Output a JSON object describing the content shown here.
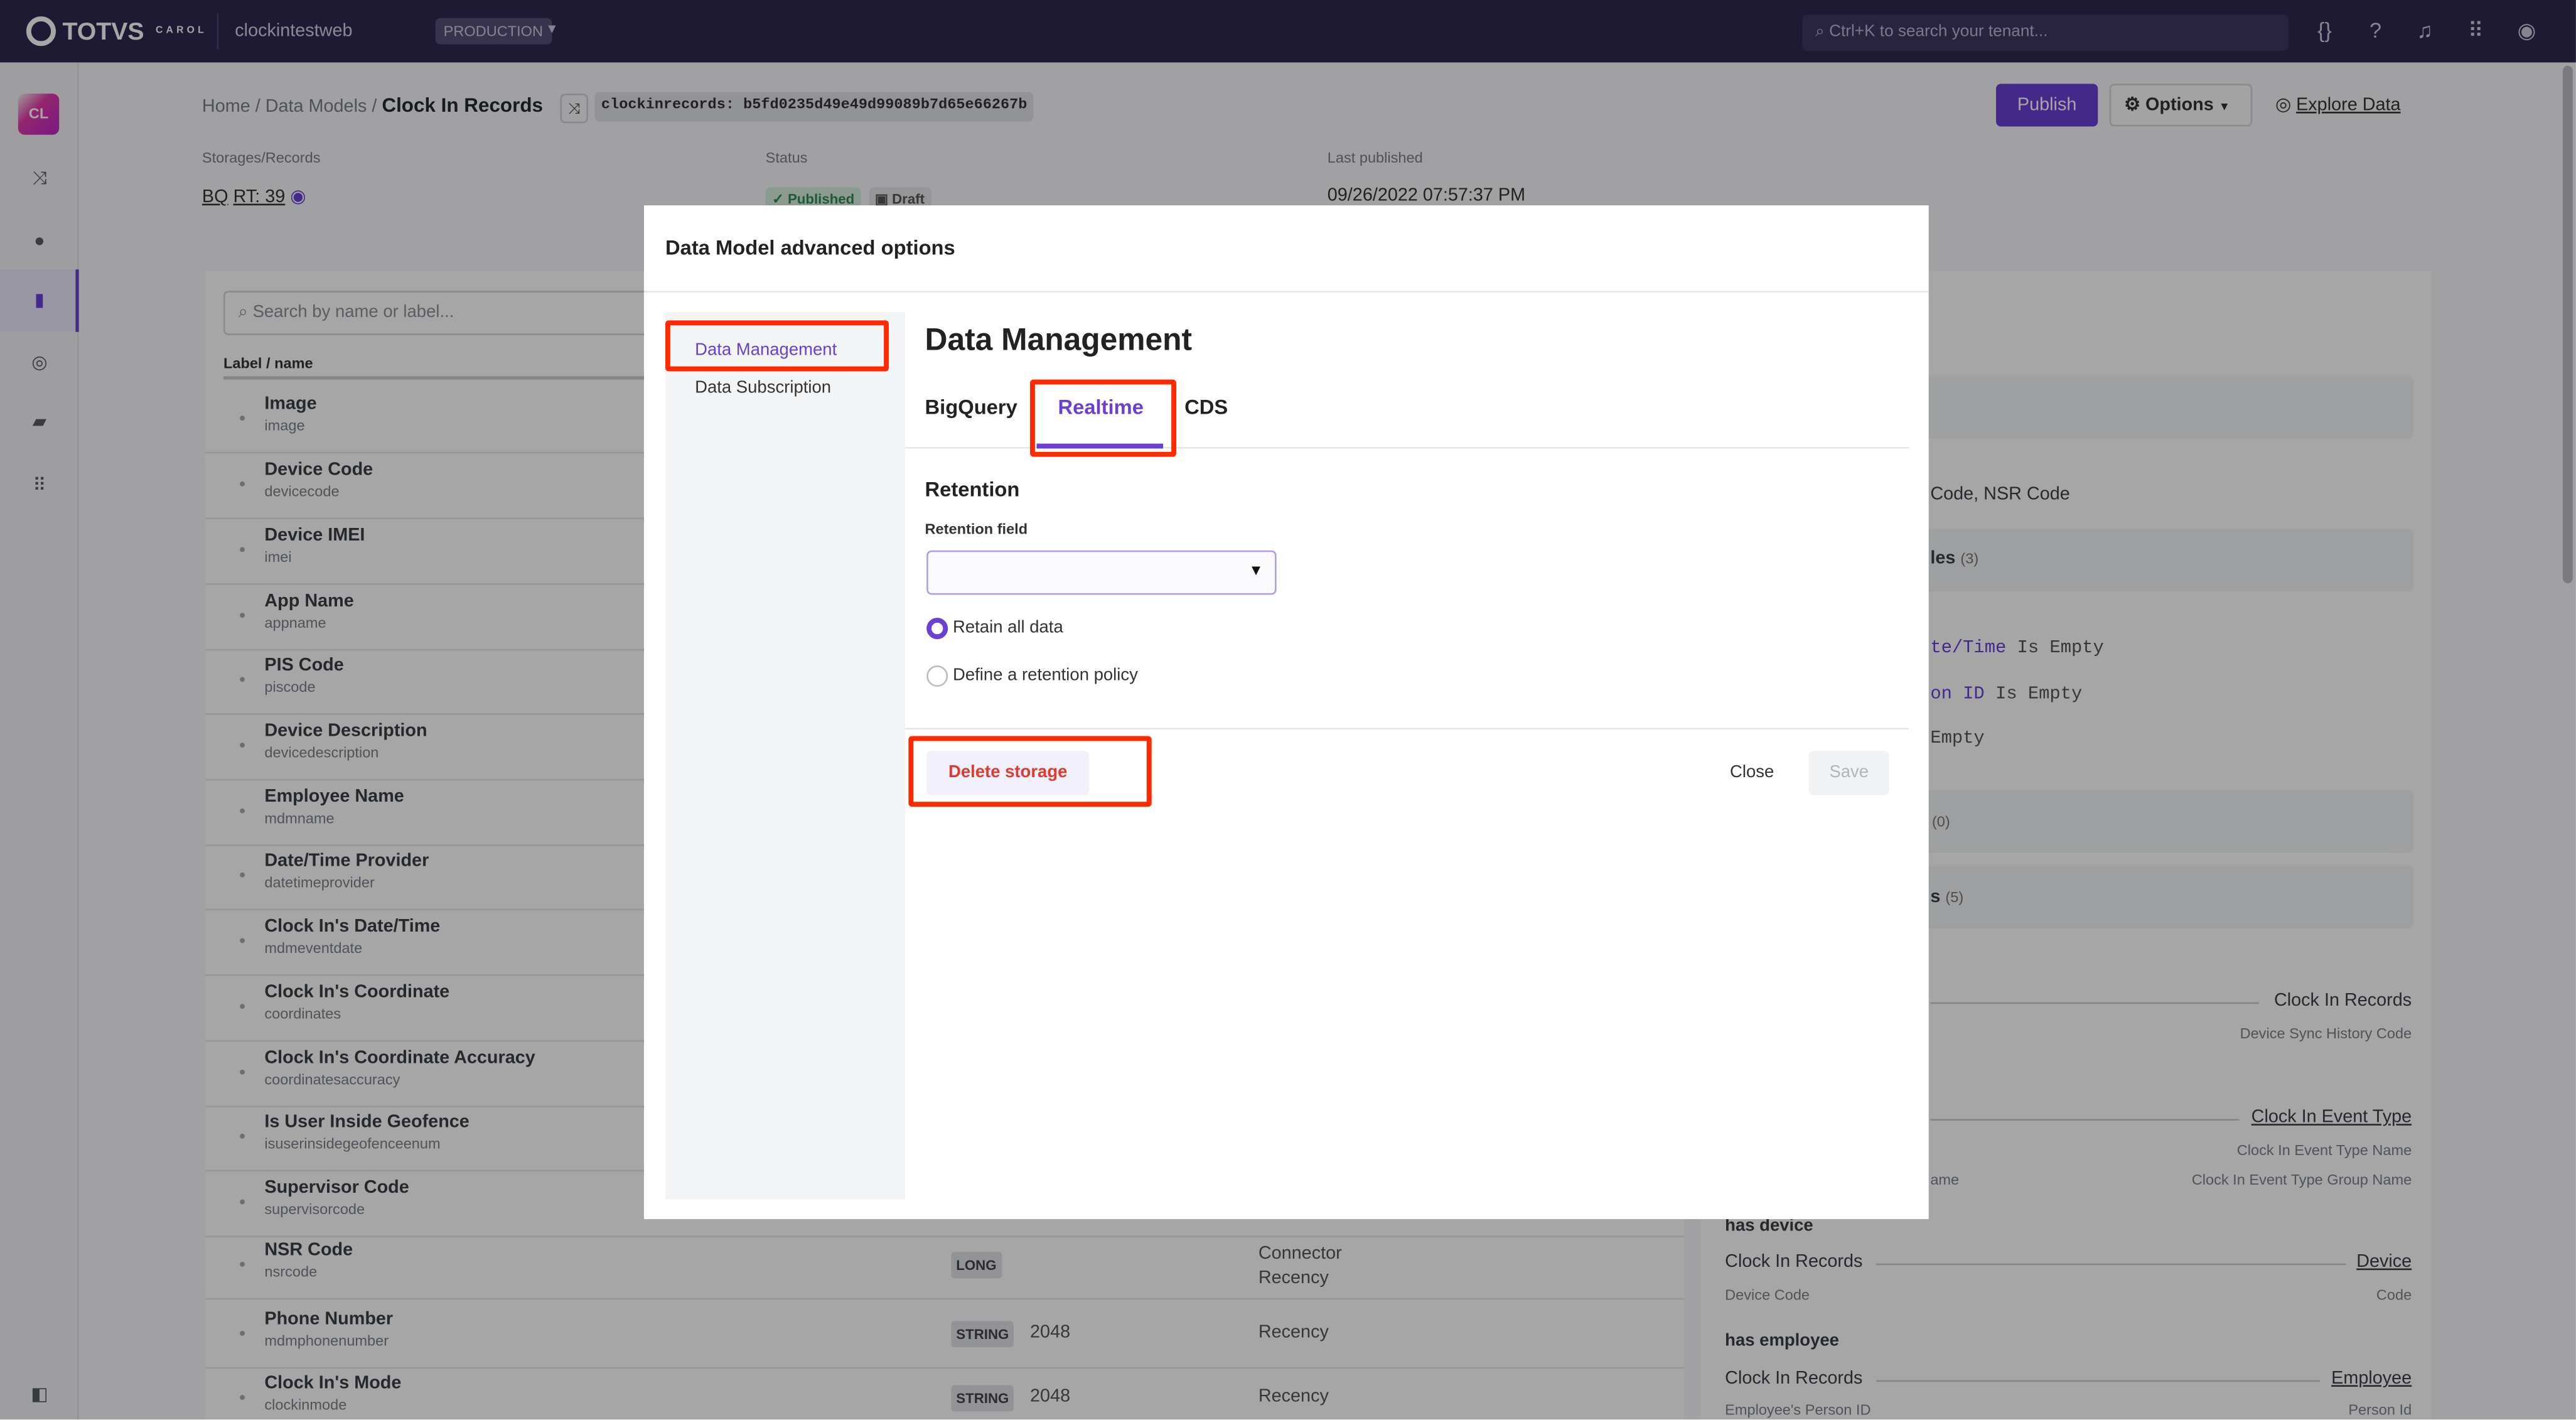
{
  "topbar": {
    "brand": "TOTVS",
    "brand_sub": "CAROL",
    "tenant": "clockintestweb",
    "environment": "PRODUCTION",
    "search_placeholder": "Ctrl+K to search your tenant...",
    "icons": [
      "code-braces-icon",
      "help-icon",
      "bell-icon",
      "apps-grid-icon",
      "user-icon"
    ]
  },
  "sidebar": {
    "avatar": "CL",
    "icons": [
      "shuffle-icon",
      "location-pin-icon",
      "database-icon",
      "compass-icon",
      "chat-icon",
      "apps-grid-icon"
    ],
    "active_index": 2,
    "collapse_icon": "sidebar-toggle-icon"
  },
  "header": {
    "breadcrumb_home": "Home",
    "breadcrumb_models": "Data Models",
    "breadcrumb_current": "Clock In Records",
    "hash": "clockinrecords: b5fd0235d49e49d99089b7d65e66267b",
    "storages_label": "Storages/Records",
    "storage_bq": "BQ",
    "storage_rt": "RT: 39",
    "status_label": "Status",
    "status_published": "Published",
    "status_draft": "Draft",
    "last_published_label": "Last published",
    "last_published": "09/26/2022 07:57:37 PM",
    "publish": "Publish",
    "options": "Options",
    "explore": "Explore Data"
  },
  "fields": {
    "search_placeholder": "Search by name or label...",
    "column_label": "Label / name",
    "rows": [
      {
        "label": "Image",
        "name": "image"
      },
      {
        "label": "Device Code",
        "name": "devicecode"
      },
      {
        "label": "Device IMEI",
        "name": "imei"
      },
      {
        "label": "App Name",
        "name": "appname"
      },
      {
        "label": "PIS Code",
        "name": "piscode"
      },
      {
        "label": "Device Description",
        "name": "devicedescription"
      },
      {
        "label": "Employee Name",
        "name": "mdmname"
      },
      {
        "label": "Date/Time Provider",
        "name": "datetimeprovider"
      },
      {
        "label": "Clock In's Date/Time",
        "name": "mdmeventdate"
      },
      {
        "label": "Clock In's Coordinate",
        "name": "coordinates"
      },
      {
        "label": "Clock In's Coordinate Accuracy",
        "name": "coordinatesaccuracy"
      },
      {
        "label": "Is User Inside Geofence",
        "name": "isuserinsidegeofenceenum"
      },
      {
        "label": "Supervisor Code",
        "name": "supervisorcode"
      },
      {
        "label": "NSR Code",
        "name": "nsrcode",
        "type": "LONG",
        "size": "",
        "meta1": "Connector",
        "meta2": "Recency"
      },
      {
        "label": "Phone Number",
        "name": "mdmphonenumber",
        "type": "STRING",
        "size": "2048",
        "meta1": "Recency",
        "meta2": ""
      },
      {
        "label": "Clock In's Mode",
        "name": "clockinmode",
        "type": "STRING",
        "size": "2048",
        "meta1": "Recency",
        "meta2": ""
      }
    ]
  },
  "right_panel": {
    "keys_text": "Code, NSR Code",
    "rules_title": "les",
    "rules_count": "(3)",
    "rule1_field": "te/Time",
    "rule1_op": "Is Empty",
    "rule2_field": "on ID",
    "rule2_op": "Is Empty",
    "rule3_op": "Empty",
    "section3_count": "(0)",
    "section4_title": "s",
    "section4_count": "(5)",
    "rel1_target": "Clock In Records",
    "rel1_target_field": "Device Sync History Code",
    "rel2_target": "Clock In Event Type",
    "rel2_target_field1": "Clock In Event Type Name",
    "rel2_source_field2": "ame",
    "rel2_target_field2": "Clock In Event Type Group Name",
    "rel3_title": "has device",
    "rel3_source": "Clock In Records",
    "rel3_target": "Device",
    "rel3_source_field": "Device Code",
    "rel3_target_field": "Code",
    "rel4_title": "has employee",
    "rel4_source": "Clock In Records",
    "rel4_target": "Employee",
    "rel4_source_field": "Employee's Person ID",
    "rel4_target_field": "Person Id"
  },
  "modal": {
    "title": "Data Model advanced options",
    "nav": [
      "Data Management",
      "Data Subscription"
    ],
    "heading": "Data Management",
    "tabs": [
      "BigQuery",
      "Realtime",
      "CDS"
    ],
    "active_tab": "Realtime",
    "retention_title": "Retention",
    "retention_field_label": "Retention field",
    "retention_field_value": "",
    "radio_retain_all": "Retain all data",
    "radio_define_policy": "Define a retention policy",
    "selected_radio": "Retain all data",
    "delete": "Delete storage",
    "close": "Close",
    "save": "Save"
  },
  "colors": {
    "accent": "#6b3fd4",
    "danger": "#e03a2e",
    "highlight": "#ff2a00",
    "topbar": "#2e2850"
  }
}
